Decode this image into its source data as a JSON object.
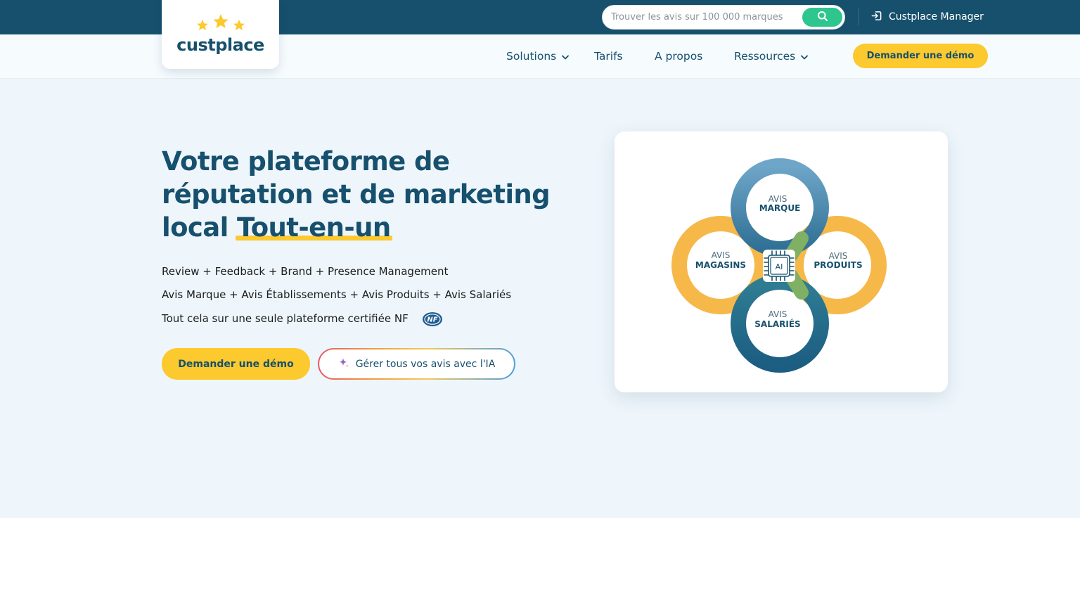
{
  "topbar": {
    "search": {
      "placeholder": "Trouver les avis sur 100 000 marques"
    },
    "manager_label": "Custplace Manager"
  },
  "brand": {
    "logo_text": "custplace"
  },
  "nav": {
    "items": [
      {
        "label": "Solutions",
        "has_dropdown": true
      },
      {
        "label": "Tarifs",
        "has_dropdown": false
      },
      {
        "label": "A propos",
        "has_dropdown": false
      },
      {
        "label": "Ressources",
        "has_dropdown": true
      }
    ],
    "cta": "Demander une démo"
  },
  "hero": {
    "title_part1": "Votre plateforme de réputation et de marketing local ",
    "title_highlight": "Tout-en-un",
    "lines": [
      "Review + Feedback + Brand + Presence Management",
      "Avis Marque + Avis Établissements + Avis Produits + Avis Salariés",
      "Tout cela sur une seule plateforme certifiée NF"
    ],
    "nf_badge_text": "NF",
    "cta_primary": "Demander une démo",
    "cta_secondary": "Gérer tous vos avis avec l'IA"
  },
  "diagram": {
    "center_label": "AI",
    "petals": [
      {
        "top": "AVIS",
        "bottom": "MARQUE"
      },
      {
        "top": "AVIS",
        "bottom": "MAGASINS"
      },
      {
        "top": "AVIS",
        "bottom": "PRODUITS"
      },
      {
        "top": "AVIS",
        "bottom": "SALARIÉS"
      }
    ]
  },
  "colors": {
    "brand_dark": "#16506d",
    "accent_yellow": "#fcc92e",
    "search_green": "#2fc58f",
    "hero_bg": "#eef6fb"
  }
}
